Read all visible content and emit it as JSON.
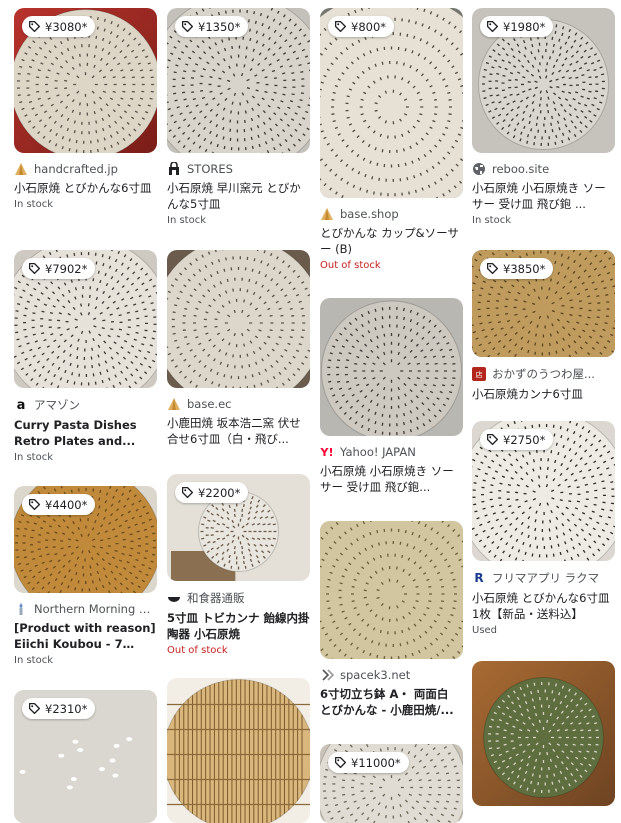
{
  "colors": {
    "out_of_stock": "#c5221f",
    "muted": "#4d5156"
  },
  "columns": [
    [
      {
        "price": "¥3080*",
        "source_icon": "pyramid-favicon",
        "source": "handcrafted.jp",
        "title": "小石原焼 とびかんな6寸皿",
        "status": "In stock",
        "status_type": "stock"
      },
      {
        "price": "¥7902*",
        "source_icon": "amazon-logo",
        "source": "アマゾン",
        "title": "Curry Pasta Dishes Retro Plates and...",
        "status": "In stock",
        "status_type": "stock"
      },
      {
        "price": "¥4400*",
        "source_icon": "candle-favicon",
        "source": "Northern Morning S...",
        "title": "[Product with reason] Eiichi Koubou - 7 inch...",
        "status": "In stock",
        "status_type": "stock"
      },
      {
        "price": "¥2310*"
      }
    ],
    [
      {
        "price": "¥1350*",
        "source_icon": "store-icon",
        "source": "STORES",
        "title": "小石原焼 早川窯元 とびかんな5寸皿",
        "status": "In stock",
        "status_type": "stock"
      },
      {
        "source_icon": "pyramid-favicon",
        "source": "base.ec",
        "title": "小鹿田焼 坂本浩二窯 伏せ合せ6寸皿（白・飛び...",
        "status": "",
        "status_type": "stock"
      },
      {
        "price": "¥2200*",
        "source_icon": "bowl-favicon",
        "source": "和食器通販",
        "title": "5寸皿 トビカンナ 飴線内掛 陶器 小石原焼",
        "status": "Out of stock",
        "status_type": "oos"
      },
      {}
    ],
    [
      {
        "price": "¥800*",
        "source_icon": "pyramid-favicon",
        "source": "base.shop",
        "title": "とびかんな カップ&ソーサー (B)",
        "status": "Out of stock",
        "status_type": "oos"
      },
      {
        "source_icon": "yahoo-logo",
        "source": "Yahoo! JAPAN",
        "title": "小石原焼 小石原焼き ソーサー 受け皿 飛び鉋...",
        "status": "",
        "status_type": "stock"
      },
      {
        "source_icon": "spacek-logo",
        "source": "spacek3.net",
        "title": "6寸切立ち鉢 A・ 両面白 とびかんな - 小鹿田焼/...",
        "status": "",
        "status_type": "stock"
      },
      {
        "price": "¥11000*"
      }
    ],
    [
      {
        "price": "¥1980*",
        "source_icon": "globe-icon",
        "source": "reboo.site",
        "title": "小石原焼 小石原焼き ソーサー 受け皿 飛び鉋 ...",
        "status": "In stock",
        "status_type": "stock"
      },
      {
        "price": "¥3850*",
        "source_icon": "shop-favicon",
        "source": "おかずのうつわ屋...",
        "title": "小石原焼カンナ6寸皿",
        "status": "",
        "status_type": "stock"
      },
      {
        "price": "¥2750*",
        "source_icon": "rakuma-logo",
        "source": "フリマアプリ ラクマ",
        "title": "小石原焼 とびかんな6寸皿1枚【新品・送料込】",
        "status": "Used",
        "status_type": "stock"
      },
      {}
    ]
  ]
}
